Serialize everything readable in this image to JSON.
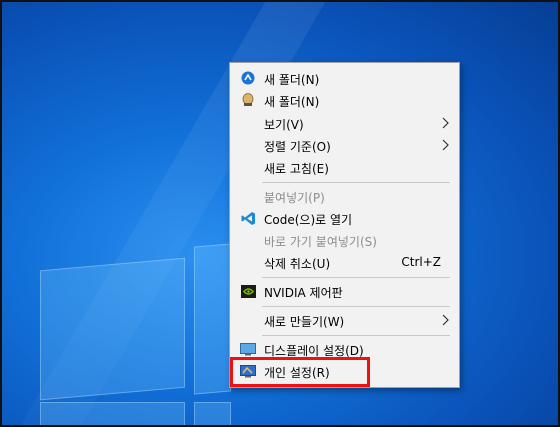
{
  "menu": {
    "items": [
      {
        "label": "새 폴더(N)",
        "icon": "blue-circle-app-icon",
        "disabled": false
      },
      {
        "label": "새 폴더(N)",
        "icon": "gold-user-app-icon",
        "disabled": false
      },
      {
        "label": "보기(V)",
        "submenu": true,
        "disabled": false
      },
      {
        "label": "정렬 기준(O)",
        "submenu": true,
        "disabled": false
      },
      {
        "label": "새로 고침(E)",
        "disabled": false
      },
      {
        "label": "붙여넣기(P)",
        "disabled": true
      },
      {
        "label": "Code(으)로 열기",
        "icon": "vscode-icon",
        "disabled": false
      },
      {
        "label": "바로 가기 붙여넣기(S)",
        "disabled": true
      },
      {
        "label": "삭제 취소(U)",
        "shortcut": "Ctrl+Z",
        "disabled": false
      },
      {
        "label": "NVIDIA 제어판",
        "icon": "nvidia-icon",
        "disabled": false
      },
      {
        "label": "새로 만들기(W)",
        "submenu": true,
        "disabled": false
      },
      {
        "label": "디스플레이 설정(D)",
        "icon": "display-icon",
        "disabled": false
      },
      {
        "label": "개인 설정(R)",
        "icon": "personalize-icon",
        "disabled": false
      }
    ]
  },
  "colors": {
    "highlight": "#ee1111",
    "menu_bg": "#f2f2f2",
    "desktop": "#1170d8"
  }
}
